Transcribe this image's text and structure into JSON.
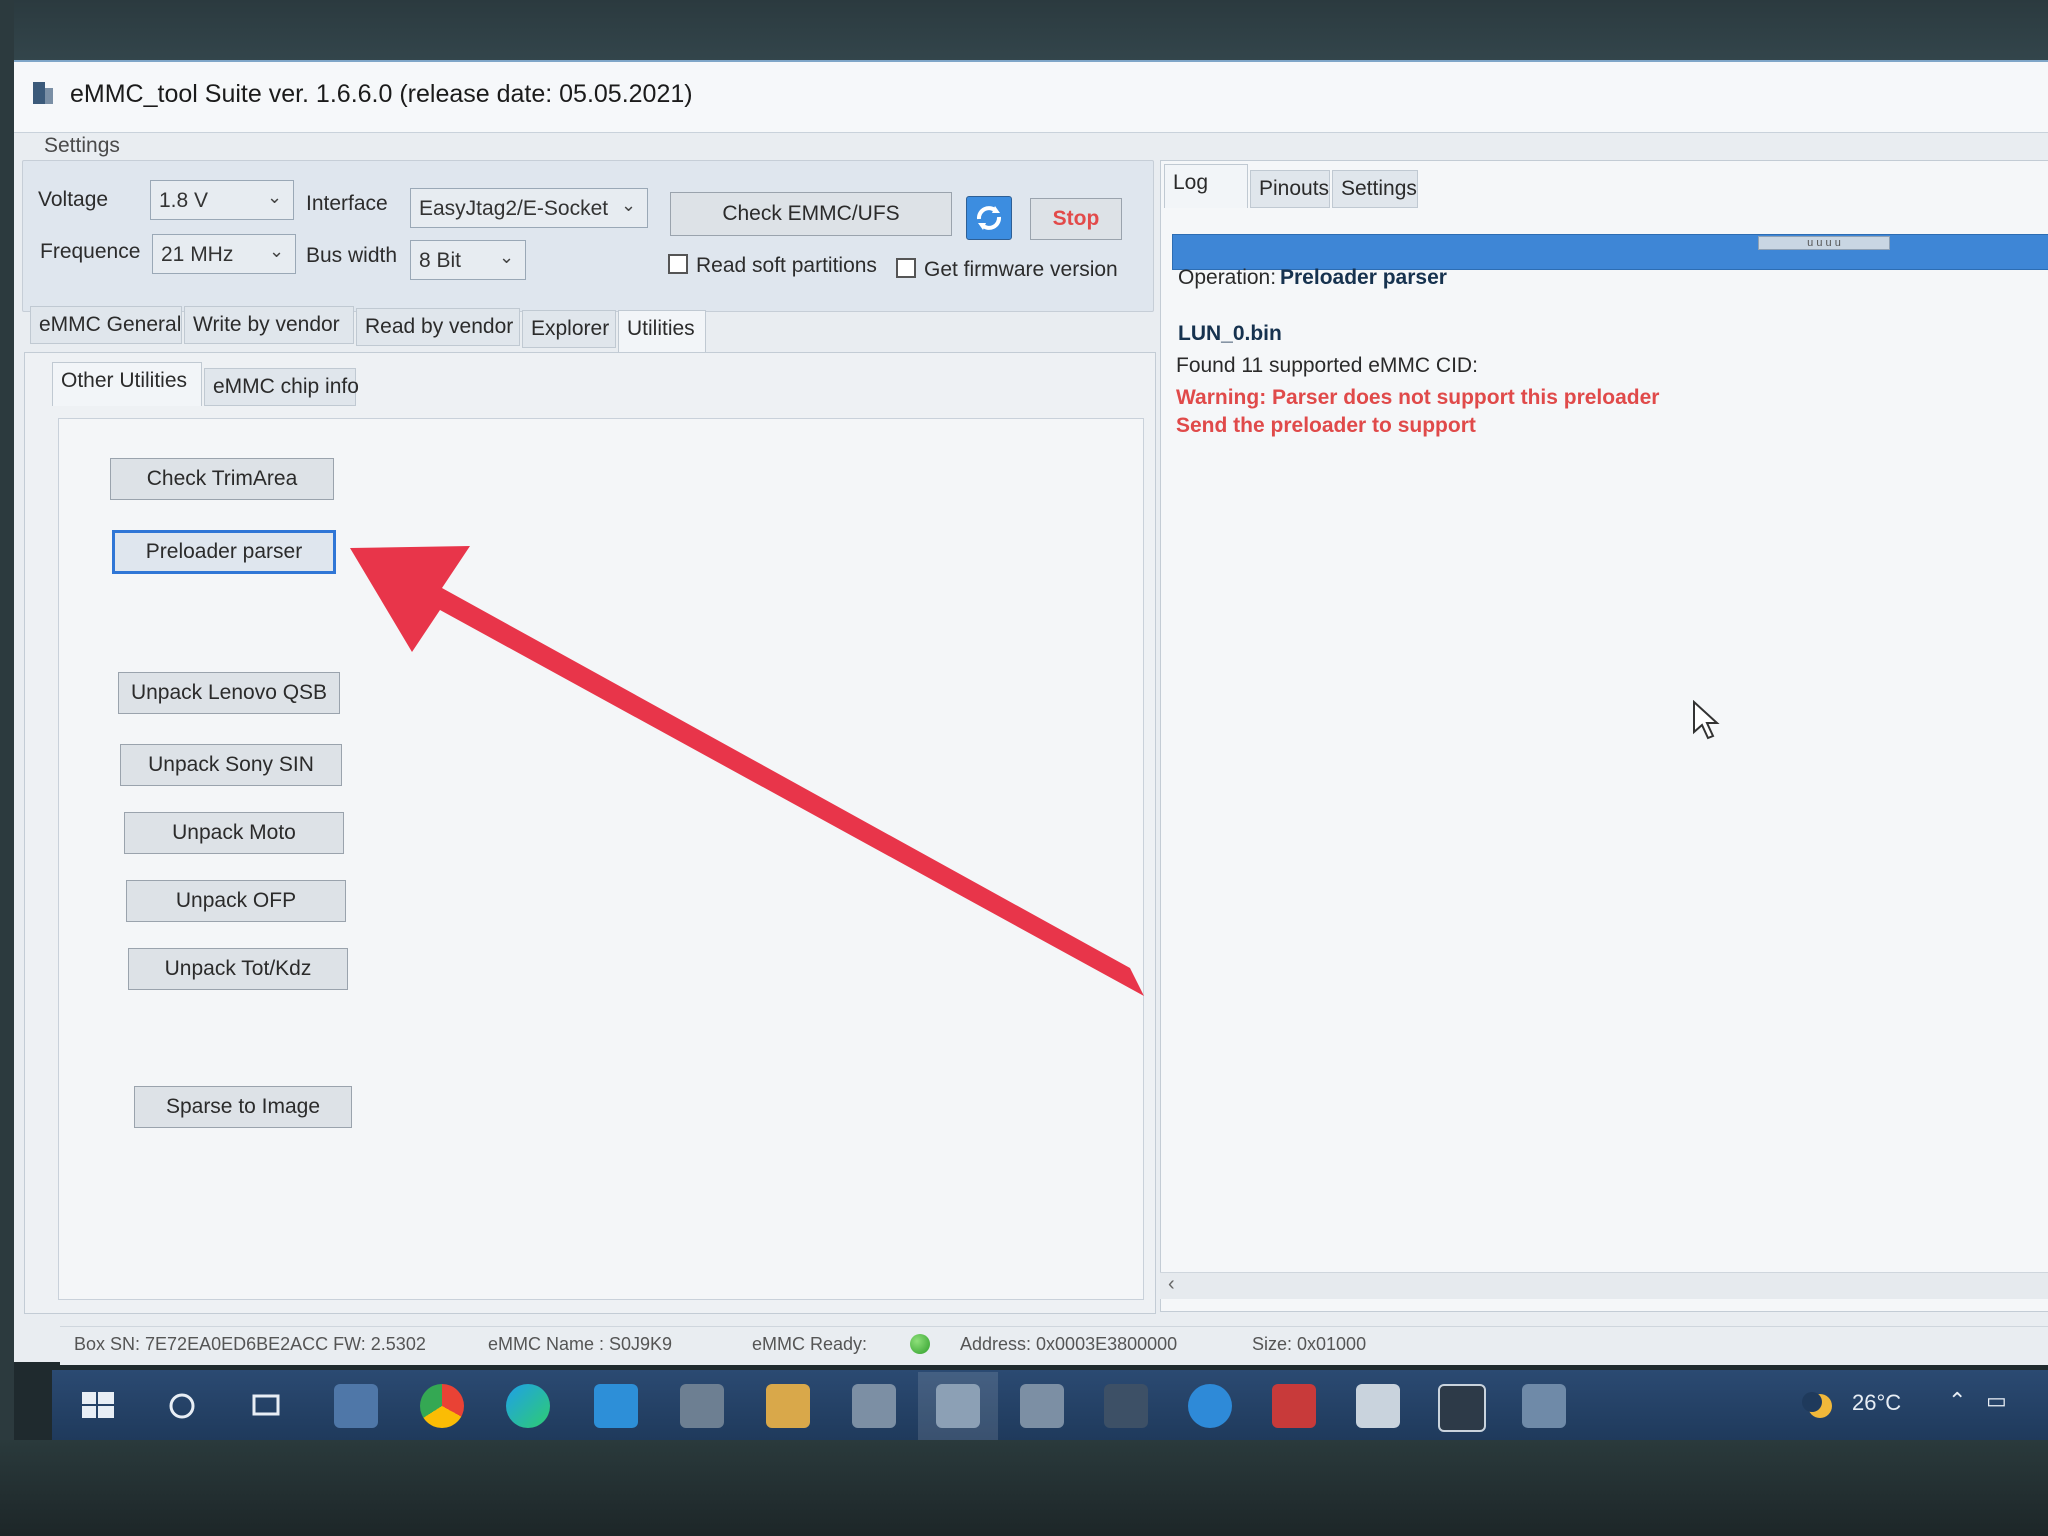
{
  "window": {
    "title": "eMMC_tool Suite  ver. 1.6.6.0 (release date: 05.05.2021)"
  },
  "settings": {
    "group_label": "Settings",
    "voltage_label": "Voltage",
    "voltage_value": "1.8 V",
    "interface_label": "Interface",
    "interface_value": "EasyJtag2/E-Socket",
    "frequence_label": "Frequence",
    "frequence_value": "21 MHz",
    "bus_width_label": "Bus width",
    "bus_width_value": "8 Bit",
    "check_button": "Check EMMC/UFS",
    "stop_button": "Stop",
    "read_soft_partitions": "Read soft partitions",
    "get_firmware_version": "Get firmware version"
  },
  "main_tabs": [
    "eMMC General",
    "Write by vendor",
    "Read by vendor",
    "Explorer",
    "Utilities"
  ],
  "sub_tabs": [
    "Other Utilities",
    "eMMC chip info"
  ],
  "utilities": {
    "check_trimarea": "Check TrimArea",
    "preloader_parser": "Preloader parser",
    "unpack_lenovo": "Unpack Lenovo QSB",
    "unpack_sony": "Unpack Sony SIN",
    "unpack_moto": "Unpack Moto",
    "unpack_ofp": "Unpack OFP",
    "unpack_tot": "Unpack Tot/Kdz",
    "sparse_to_image": "Sparse to Image"
  },
  "right_tabs": [
    "Log",
    "Pinouts",
    "Settings"
  ],
  "log": {
    "operation_prefix": "Operation:",
    "operation_name": "Preloader parser",
    "file": "LUN_0.bin",
    "found": "Found 11 supported eMMC CID:",
    "warning": "Warning: Parser does not support this preloader",
    "send": "Send the preloader to support"
  },
  "statusbar": {
    "box_sn": "Box SN:  7E72EA0ED6BE2ACC  FW:  2.5302",
    "emmc_name": "eMMC Name : S0J9K9",
    "emmc_ready": "eMMC Ready:",
    "address": "Address: 0x0003E3800000",
    "size": "Size: 0x01000"
  },
  "taskbar": {
    "temperature": "26°C"
  },
  "colors": {
    "accent": "#2f76d6",
    "warning": "#e04a4a",
    "arrow": "#e8354a",
    "taskbar": "#1f3a5c"
  }
}
